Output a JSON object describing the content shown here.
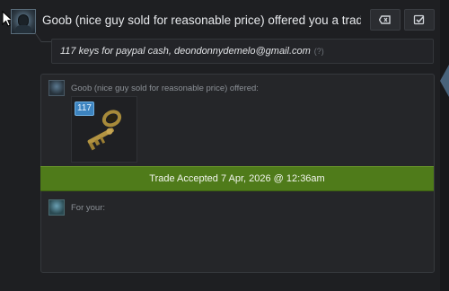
{
  "trade": {
    "headline": "Goob (nice guy sold for reasonable price) offered you a trade:",
    "message": "117 keys for paypal cash, deondonnydemelo@gmail.com",
    "message_help": "(?)",
    "offered_label": "Goob (nice guy sold for reasonable price) offered:",
    "item": {
      "name": "Mann Co. Supply Crate Key",
      "count": "117",
      "icon": "key-icon"
    },
    "status_banner": "Trade Accepted 7 Apr, 2026 @ 12:36am",
    "for_your_label": "For your:"
  },
  "buttons": {
    "decline_icon": "decline-icon",
    "accept_icon": "checkmark-icon"
  },
  "colors": {
    "accepted_banner": "#4f7b1a",
    "badge": "#3d84c0",
    "panel": "#252629"
  }
}
